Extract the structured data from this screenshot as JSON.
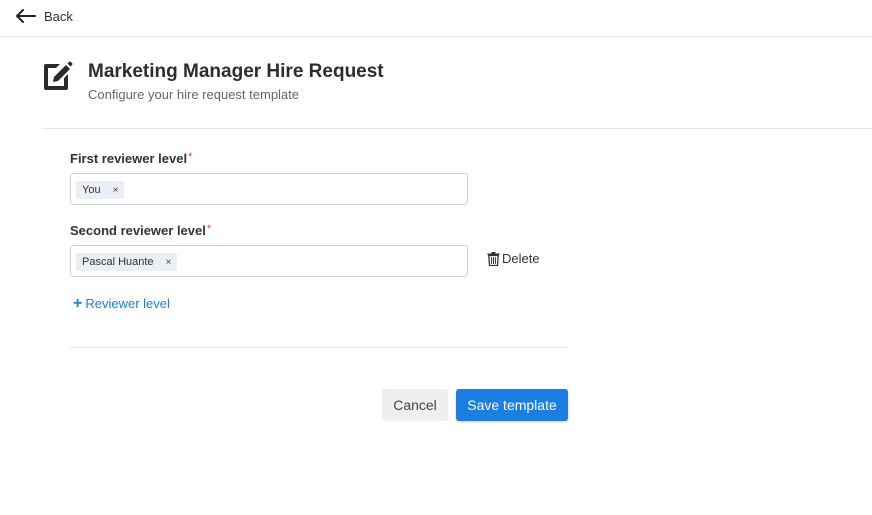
{
  "nav": {
    "back_label": "Back"
  },
  "header": {
    "title": "Marketing Manager Hire Request",
    "subtitle": "Configure your hire request template"
  },
  "form": {
    "levels": [
      {
        "label": "First reviewer level",
        "required_mark": "*",
        "chips": [
          "You"
        ]
      },
      {
        "label": "Second reviewer level",
        "required_mark": "*",
        "chips": [
          "Pascal Huante"
        ]
      }
    ],
    "chip_remove_glyph": "×",
    "delete_label": "Delete",
    "add_level_icon": "+",
    "add_level_label": "Reviewer level"
  },
  "actions": {
    "cancel_label": "Cancel",
    "save_label": "Save template"
  },
  "colors": {
    "accent": "#1a7fe0",
    "link": "#1a7fd6",
    "required": "#e0413c",
    "chip_bg": "#e9eff5"
  },
  "icons": {
    "back": "arrow-left-icon",
    "header": "edit-document-icon",
    "delete": "trash-icon",
    "add": "plus-icon"
  }
}
